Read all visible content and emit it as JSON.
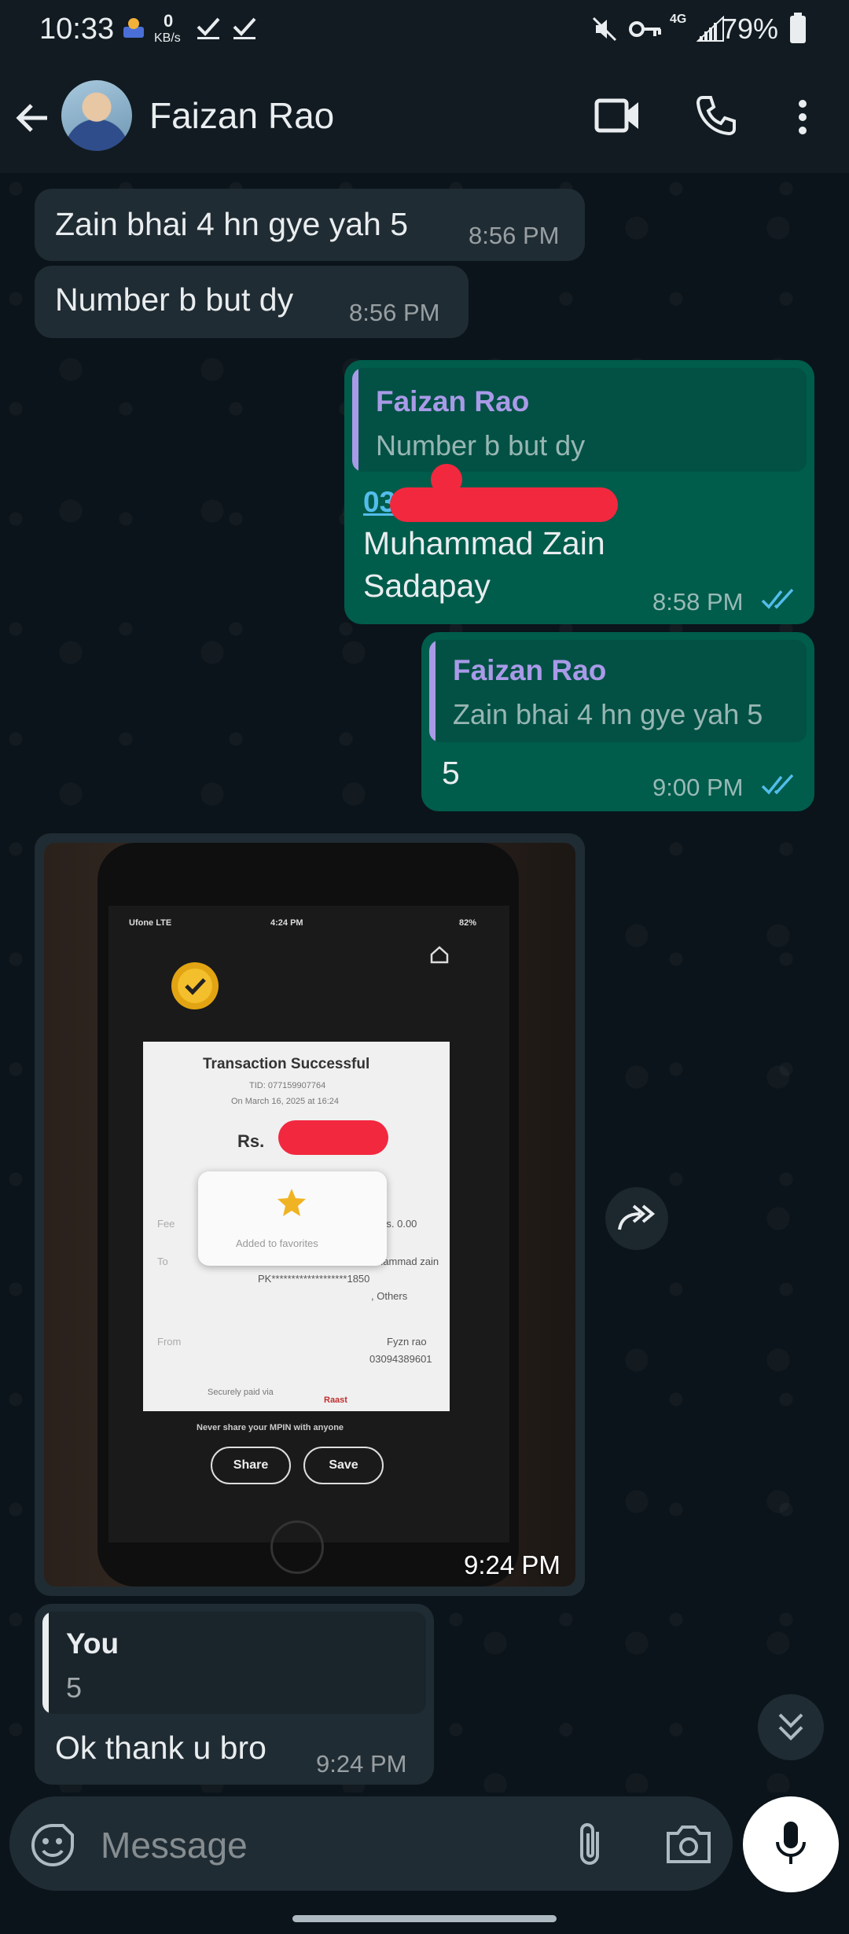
{
  "status_bar": {
    "time": "10:33",
    "net_rate_value": "0",
    "net_rate_unit": "KB/s",
    "network": "4G",
    "battery": "79%"
  },
  "header": {
    "contact_name": "Faizan Rao"
  },
  "messages": [
    {
      "dir": "in",
      "text": "Zain bhai 4 hn gye yah 5",
      "time": "8:56 PM"
    },
    {
      "dir": "in",
      "text": "Number b but dy",
      "time": "8:56 PM"
    },
    {
      "dir": "out",
      "quote_author": "Faizan Rao",
      "quote_text": "Number b but dy",
      "link_text": "03",
      "line1": "Muhammad Zain",
      "line2": "Sadapay",
      "time": "8:58 PM"
    },
    {
      "dir": "out",
      "quote_author": "Faizan Rao",
      "quote_text": "Zain bhai 4 hn gye yah 5",
      "text": "5",
      "time": "9:00 PM"
    },
    {
      "dir": "in",
      "type": "image",
      "time": "9:24 PM",
      "image": {
        "carrier": "Ufone LTE",
        "phone_time": "4:24 PM",
        "phone_battery": "82%",
        "title": "Transaction Successful",
        "tid": "TID: 07715990​7764",
        "date": "On March 16, 2025 at 16:24",
        "amount_prefix": "Rs.",
        "fee_label": "Fee",
        "fee_value": "Rs. 0.00",
        "to_label": "To",
        "to_name": "Muhammad zain",
        "to_account": "PK*******************1850",
        "to_bank": ", Others",
        "from_label": "From",
        "from_name": "Fyzn rao",
        "from_number": "03094389601",
        "secure_note": "Securely paid via",
        "brand": "Raast",
        "favorite_text": "Added to favorites",
        "mpin_note": "Never share your MPIN with anyone",
        "share_btn": "Share",
        "save_btn": "Save"
      }
    },
    {
      "dir": "in",
      "quote_author": "You",
      "quote_text": "5",
      "text": "Ok thank u bro",
      "time": "9:24 PM"
    }
  ],
  "composer": {
    "placeholder": "Message"
  },
  "icons": [
    "back-arrow-icon",
    "video-call-icon",
    "voice-call-icon",
    "more-vert-icon",
    "emoji-icon",
    "attach-icon",
    "camera-icon",
    "mic-icon",
    "forward-icon",
    "scroll-down-icon",
    "double-check-icon"
  ],
  "colors": {
    "bubble_out": "#005c4b",
    "bubble_in": "#202c33",
    "quote_author": "#a99ae8",
    "read_ticks": "#53bdeb",
    "background": "#0b141a"
  }
}
